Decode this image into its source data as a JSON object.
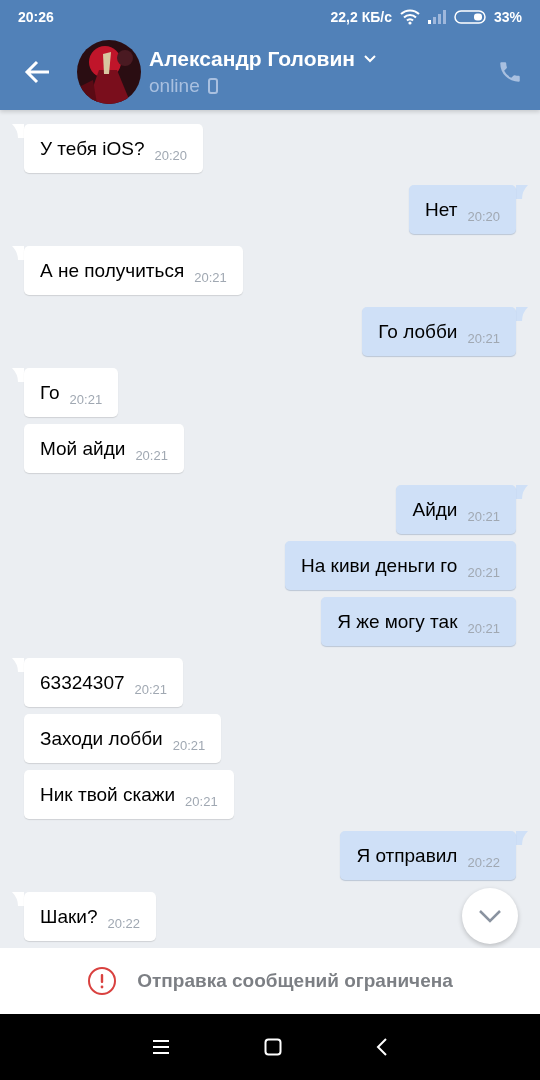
{
  "status_bar": {
    "time": "20:26",
    "speed": "22,2 КБ/с",
    "battery": "33%"
  },
  "header": {
    "name": "Александр Головин",
    "status": "online"
  },
  "messages": [
    {
      "kind": "incoming",
      "text": "У тебя iOS?",
      "time": "20:20",
      "first": true
    },
    {
      "kind": "outgoing",
      "text": "Нет",
      "time": "20:20",
      "first": true
    },
    {
      "kind": "incoming",
      "text": "А не получиться",
      "time": "20:21",
      "first": true
    },
    {
      "kind": "outgoing",
      "text": "Го лобби",
      "time": "20:21",
      "first": true
    },
    {
      "kind": "incoming",
      "text": "Го",
      "time": "20:21",
      "first": true
    },
    {
      "kind": "incoming",
      "text": "Мой айди",
      "time": "20:21",
      "first": false
    },
    {
      "kind": "outgoing",
      "text": "Айди",
      "time": "20:21",
      "first": true
    },
    {
      "kind": "outgoing",
      "text": "На киви деньги го",
      "time": "20:21",
      "first": false
    },
    {
      "kind": "outgoing",
      "text": "Я же могу так",
      "time": "20:21",
      "first": false
    },
    {
      "kind": "incoming",
      "text": "63324307",
      "time": "20:21",
      "first": true
    },
    {
      "kind": "incoming",
      "text": "Заходи лобби",
      "time": "20:21",
      "first": false
    },
    {
      "kind": "incoming",
      "text": "Ник твой скажи",
      "time": "20:21",
      "first": false
    },
    {
      "kind": "outgoing",
      "text": "Я отправил",
      "time": "20:22",
      "first": true
    },
    {
      "kind": "incoming",
      "text": "Шаки?",
      "time": "20:22",
      "first": true
    }
  ],
  "notice": "Отправка сообщений ограничена"
}
